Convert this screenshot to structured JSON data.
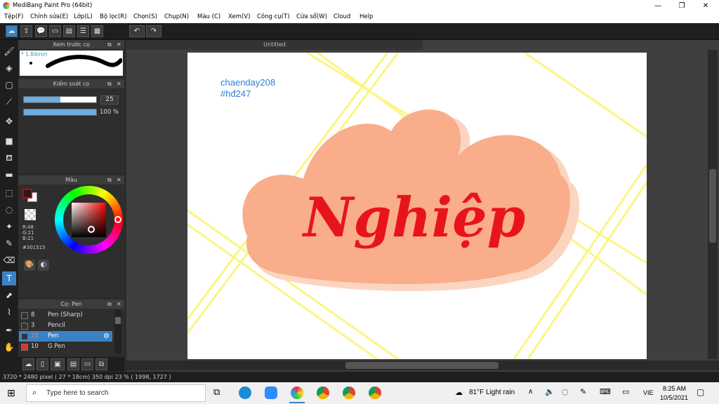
{
  "window": {
    "title": "MediBang Paint Pro (64bit)",
    "minimize": "—",
    "maximize": "❐",
    "close": "✕"
  },
  "menu": [
    "Tệp(F)",
    "Chỉnh sửa(E)",
    "Lớp(L)",
    "Bộ lọc(R)",
    "Chọn(S)",
    "Chụp(N)",
    "Màu (C)",
    "Xem(V)",
    "Công cụ(T)",
    "Cửa sổ(W)",
    "Cloud",
    "Help"
  ],
  "document": {
    "tab": "Untitled"
  },
  "brush_preview": {
    "title": "Xem trước cọ",
    "size_label": "* 1.84mm"
  },
  "brush_control": {
    "title": "Kiểm soát cọ",
    "size_value": "25",
    "opacity_value": "100 %",
    "size_fraction": 0.5,
    "opacity_fraction": 1.0
  },
  "color_panel": {
    "title": "Màu",
    "r": "R:48",
    "g": "G:21",
    "b": "B:21",
    "hex": "#301515",
    "primary": "#301515"
  },
  "brush_list": {
    "title": "Cọ: Pen",
    "items": [
      {
        "num": "8",
        "name": "Pen (Sharp)",
        "swatch": "#333333",
        "selected": false
      },
      {
        "num": "3",
        "name": "Pencil",
        "swatch": "#333333",
        "selected": false
      },
      {
        "num": "25",
        "name": "Pen",
        "swatch": "#333333",
        "selected": true
      },
      {
        "num": "10",
        "name": "G Pen",
        "swatch": "#e03030",
        "selected": false
      }
    ]
  },
  "artwork": {
    "author": "chaenday208",
    "tag": "#hđ247",
    "word": "Nghiệp",
    "cloud_color": "#f9ad8a",
    "text_color": "#e8141c",
    "line_color": "#fbf46e"
  },
  "status": {
    "text": "3720 * 2480 pixel   ( 27 * 18cm)   350 dpi   23 %   ( 1998, 1727 )"
  },
  "taskbar": {
    "search_placeholder": "Type here to search",
    "weather": "81°F  Light rain",
    "lang": "VIE",
    "time": "8:25 AM",
    "date": "10/5/2021"
  }
}
